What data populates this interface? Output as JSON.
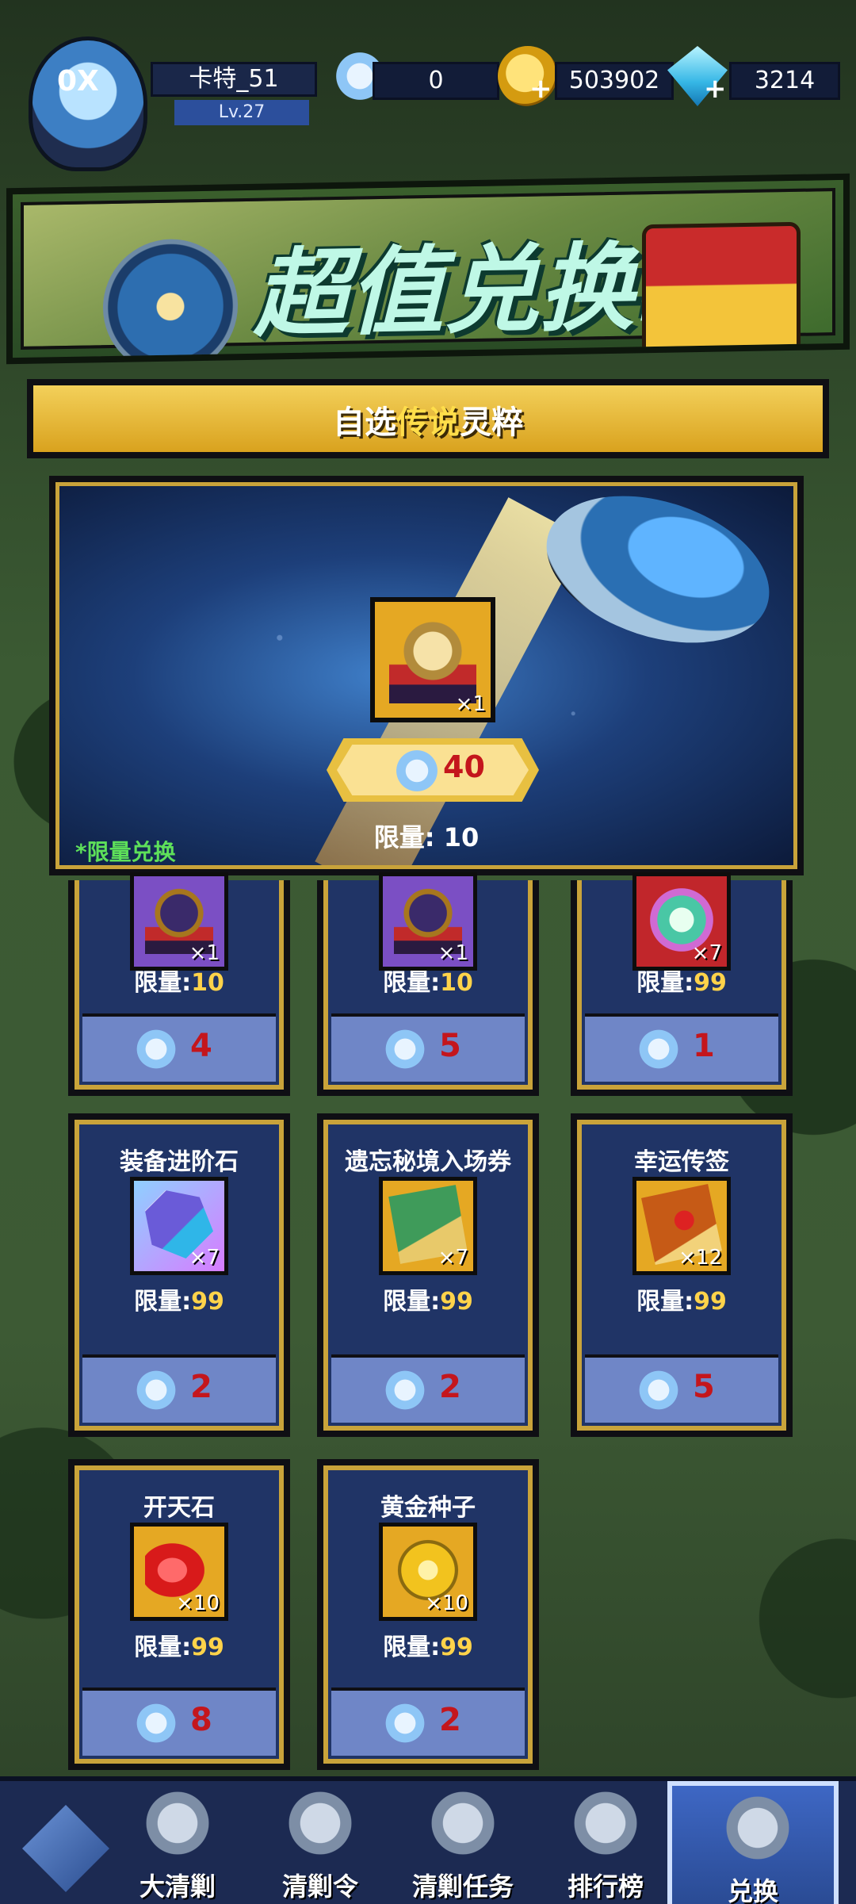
{
  "player": {
    "avatar_badge": "0X",
    "name": "卡特_51",
    "level": "Lv.27"
  },
  "resources": {
    "feather": "0",
    "coins": "503902",
    "gems": "3214"
  },
  "banner": {
    "title": "超值兑换!"
  },
  "featured": {
    "header_prefix": "自选",
    "header_highlight": "传说",
    "header_suffix": "灵粹",
    "item_qty": "×1",
    "price": "40",
    "limit": "限量: 10",
    "note": "*限量兑换"
  },
  "cards_row1": [
    {
      "qty": "×1",
      "limit_label": "限量:",
      "limit_value": "10",
      "price": "4"
    },
    {
      "qty": "×1",
      "limit_label": "限量:",
      "limit_value": "10",
      "price": "5"
    },
    {
      "qty": "×7",
      "limit_label": "限量:",
      "limit_value": "99",
      "price": "1"
    }
  ],
  "cards_row2": [
    {
      "name": "装备进阶石",
      "qty": "×7",
      "limit_label": "限量:",
      "limit_value": "99",
      "price": "2"
    },
    {
      "name": "遗忘秘境入场券",
      "qty": "×7",
      "limit_label": "限量:",
      "limit_value": "99",
      "price": "2"
    },
    {
      "name": "幸运传签",
      "qty": "×12",
      "limit_label": "限量:",
      "limit_value": "99",
      "price": "5"
    }
  ],
  "cards_row3": [
    {
      "name": "开天石",
      "qty": "×10",
      "limit_label": "限量:",
      "limit_value": "99",
      "price": "8"
    },
    {
      "name": "黄金种子",
      "qty": "×10",
      "limit_label": "限量:",
      "limit_value": "99",
      "price": "2"
    }
  ],
  "nav": {
    "items": [
      "大清剿",
      "清剿令",
      "清剿任务",
      "排行榜",
      "兑换"
    ],
    "active": "兑换"
  },
  "colors": {
    "price_red": "#c4161c",
    "limit_gold": "#ffd34a",
    "note_green": "#5ee05a",
    "frame_gold": "#c9a33a"
  }
}
